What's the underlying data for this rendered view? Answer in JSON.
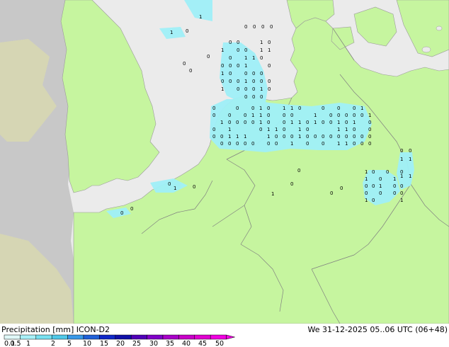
{
  "colors": {
    "sea": "#ebebeb",
    "land_inside_domain": "#c6f59f",
    "land_outside_domain": "#c8c8c8",
    "land_outside_domain_2": "#d6d6b4",
    "precip_light": "#a0f0f8",
    "border": "#808080",
    "coast": "#9a9a9a"
  },
  "footer": {
    "title": "Precipitation [mm]  ICON-D2",
    "datetime": "We 31-12-2025 05..06 UTC (06+48)"
  },
  "legend": {
    "ticks": [
      "0.1",
      "0.5",
      "1",
      "2",
      "5",
      "10",
      "15",
      "20",
      "25",
      "30",
      "35",
      "40",
      "45",
      "50"
    ],
    "colors": [
      "#e0f8f8",
      "#a8f0f8",
      "#78e0f0",
      "#50c8e8",
      "#3898e8",
      "#2060d8",
      "#1028c8",
      "#1010a8",
      "#5000b8",
      "#8000c8",
      "#a800c8",
      "#c800c8",
      "#e000d0",
      "#f000e0"
    ]
  },
  "markers": {
    "values_shown": [
      "0",
      "1"
    ]
  }
}
